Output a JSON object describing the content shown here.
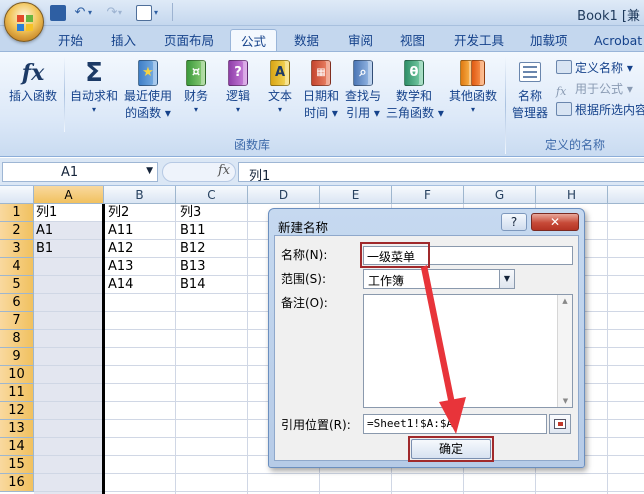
{
  "window": {
    "title": "Book1 [兼"
  },
  "ribbon": {
    "tabs": [
      "开始",
      "插入",
      "页面布局",
      "公式",
      "数据",
      "审阅",
      "视图",
      "开发工具",
      "加载项",
      "Acrobat"
    ],
    "active_tab": "公式",
    "buttons": [
      {
        "line1": "插入函数",
        "line2": "",
        "icon": "fx-icon"
      },
      {
        "line1": "自动求和",
        "line2": "▾",
        "icon": "sigma-icon"
      },
      {
        "line1": "最近使用",
        "line2": "的函数 ▾",
        "icon": "star-book-icon"
      },
      {
        "line1": "财务",
        "line2": "▾",
        "icon": "finance-book-icon"
      },
      {
        "line1": "逻辑",
        "line2": "▾",
        "icon": "question-book-icon"
      },
      {
        "line1": "文本",
        "line2": "▾",
        "icon": "text-book-icon"
      },
      {
        "line1": "日期和",
        "line2": "时间 ▾",
        "icon": "calendar-book-icon"
      },
      {
        "line1": "查找与",
        "line2": "引用 ▾",
        "icon": "lookup-book-icon"
      },
      {
        "line1": "数学和",
        "line2": "三角函数 ▾",
        "icon": "theta-book-icon"
      },
      {
        "line1": "其他函数",
        "line2": "▾",
        "icon": "more-books-icon"
      }
    ],
    "group_function_library": "函数库",
    "names_manager": {
      "line1": "名称",
      "line2": "管理器"
    },
    "define_name": "定义名称 ▾",
    "use_in_formula": "用于公式 ▾",
    "create_from_selection": "根据所选内容",
    "group_defined_names": "定义的名称"
  },
  "formula_bar": {
    "name_box": "A1",
    "fx": "fx",
    "content": "列1"
  },
  "grid": {
    "columns": [
      "A",
      "B",
      "C",
      "D",
      "E",
      "F",
      "G",
      "H"
    ],
    "rows": [
      "1",
      "2",
      "3",
      "4",
      "5",
      "6",
      "7",
      "8",
      "9",
      "10",
      "11",
      "12",
      "13",
      "14",
      "15",
      "16"
    ],
    "cells": {
      "A1": "列1",
      "A2": "A1",
      "A3": "B1",
      "B1": "列2",
      "B2": "A11",
      "B3": "A12",
      "B4": "A13",
      "B5": "A14",
      "C1": "列3",
      "C2": "B11",
      "C3": "B12",
      "C4": "B13",
      "C5": "B14"
    },
    "selected_column": "A"
  },
  "dialog": {
    "title": "新建名称",
    "help": "?",
    "close": "✕",
    "name_label": "名称(N):",
    "name_value": "一级菜单",
    "scope_label": "范围(S):",
    "scope_value": "工作簿",
    "comment_label": "备注(O):",
    "ref_label": "引用位置(R):",
    "ref_value": "=Sheet1!$A:$A",
    "ok_label": "确定"
  },
  "colors": {
    "highlight": "#a0292b",
    "arrow": "#e8343a",
    "selection_fill": "#e3e6f0"
  }
}
